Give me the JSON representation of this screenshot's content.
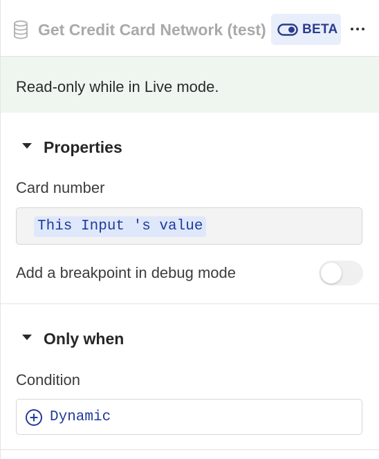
{
  "header": {
    "title": "Get Credit Card Network (test)",
    "badge_label": "BETA",
    "icons": {
      "database": "database-icon",
      "toggle": "toggle-icon",
      "more": "more-horizontal-icon"
    }
  },
  "banner": {
    "text": "Read-only while in Live mode."
  },
  "properties": {
    "title": "Properties",
    "card_number_label": "Card number",
    "card_number_value": "This Input 's value",
    "breakpoint_label": "Add a breakpoint in debug mode",
    "breakpoint_enabled": false
  },
  "only_when": {
    "title": "Only when",
    "condition_label": "Condition",
    "condition_value": "Dynamic"
  },
  "colors": {
    "accent": "#2b3d8c",
    "token_text": "#1f3a9c",
    "token_bg": "#dfe8fa",
    "banner_bg": "#eff6ef",
    "badge_bg": "#e9eefb"
  }
}
